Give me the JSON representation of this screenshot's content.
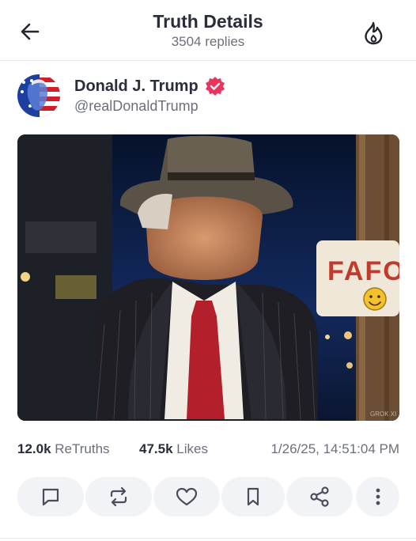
{
  "header": {
    "title": "Truth Details",
    "replies": "3504 replies",
    "back_icon": "arrow-left-icon",
    "flame_icon": "flame-icon"
  },
  "post": {
    "author_name": "Donald J. Trump",
    "handle": "@realDonaldTrump",
    "verified_color": "#e8355f",
    "image": {
      "sign_text": "FAFO",
      "watermark": "GROK XI"
    }
  },
  "stats": {
    "retruths_count": "12.0k",
    "retruths_label": "ReTruths",
    "likes_count": "47.5k",
    "likes_label": "Likes",
    "timestamp": "1/26/25, 14:51:04 PM"
  },
  "actions": [
    {
      "name": "reply",
      "icon": "comment-icon"
    },
    {
      "name": "retruth",
      "icon": "repost-icon"
    },
    {
      "name": "like",
      "icon": "heart-icon"
    },
    {
      "name": "bookmark",
      "icon": "bookmark-icon"
    },
    {
      "name": "share",
      "icon": "share-icon"
    },
    {
      "name": "more",
      "icon": "more-vertical-icon"
    }
  ]
}
